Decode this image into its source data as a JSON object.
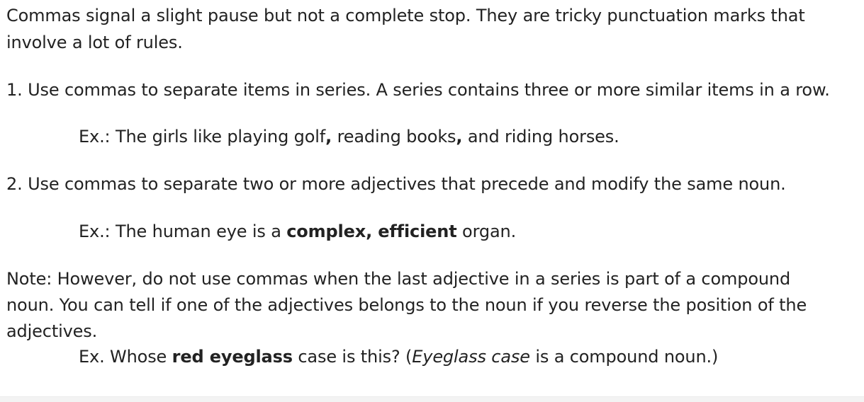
{
  "document": {
    "intro": {
      "line1": "Commas signal a slight pause but not a complete stop. They are tricky punctuation marks that",
      "line2": "involve a lot of rules."
    },
    "rule1": {
      "text": "1. Use commas to separate items in series. A series contains three or more similar items in a row.",
      "example": {
        "part1": "Ex.: The girls like playing golf",
        "comma1": ",",
        "part2": " reading books",
        "comma2": ",",
        "part3": " and riding horses."
      }
    },
    "rule2": {
      "text": "2. Use commas to separate two or more adjectives that precede and modify the same noun.",
      "example": {
        "before": "Ex.: The human eye is a ",
        "bold": "complex, efficient",
        "after": " organ."
      }
    },
    "note": {
      "line1": "Note: However, do not use commas when the last adjective in a series is part of a compound",
      "line2": "noun. You can tell if one of the adjectives belongs to the noun if you reverse the position of the",
      "line3": "adjectives.",
      "example": {
        "before": "Ex. Whose ",
        "bold": "red eyeglass",
        "middle": " case is this? (",
        "italic": "Eyeglass case",
        "after": " is a compound noun.)"
      }
    }
  }
}
